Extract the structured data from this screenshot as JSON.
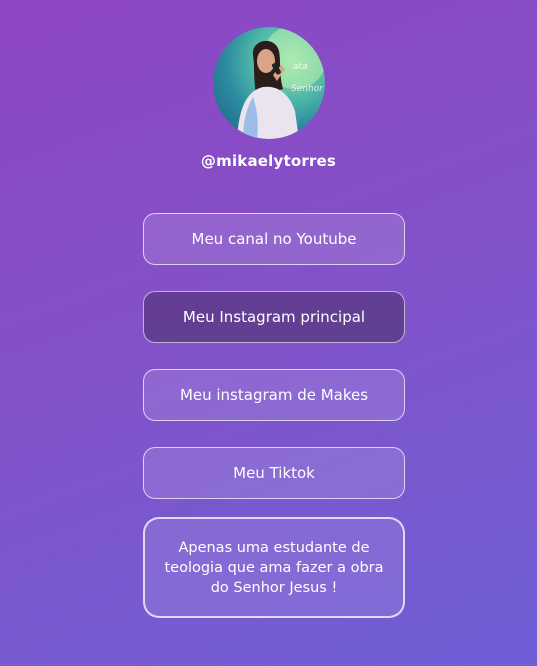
{
  "profile": {
    "handle": "@mikaelytorres",
    "avatar_icon": "avatar-photo"
  },
  "links": [
    {
      "label": "Meu canal no Youtube"
    },
    {
      "label": "Meu Instagram principal"
    },
    {
      "label": "Meu instagram de Makes"
    },
    {
      "label": "Meu Tiktok"
    }
  ],
  "bio": {
    "text": "Apenas uma estudante de teologia que ama fazer a obra do Senhor Jesus !"
  },
  "colors": {
    "background_start": "#8e45c3",
    "background_end": "#6e5ed6"
  }
}
